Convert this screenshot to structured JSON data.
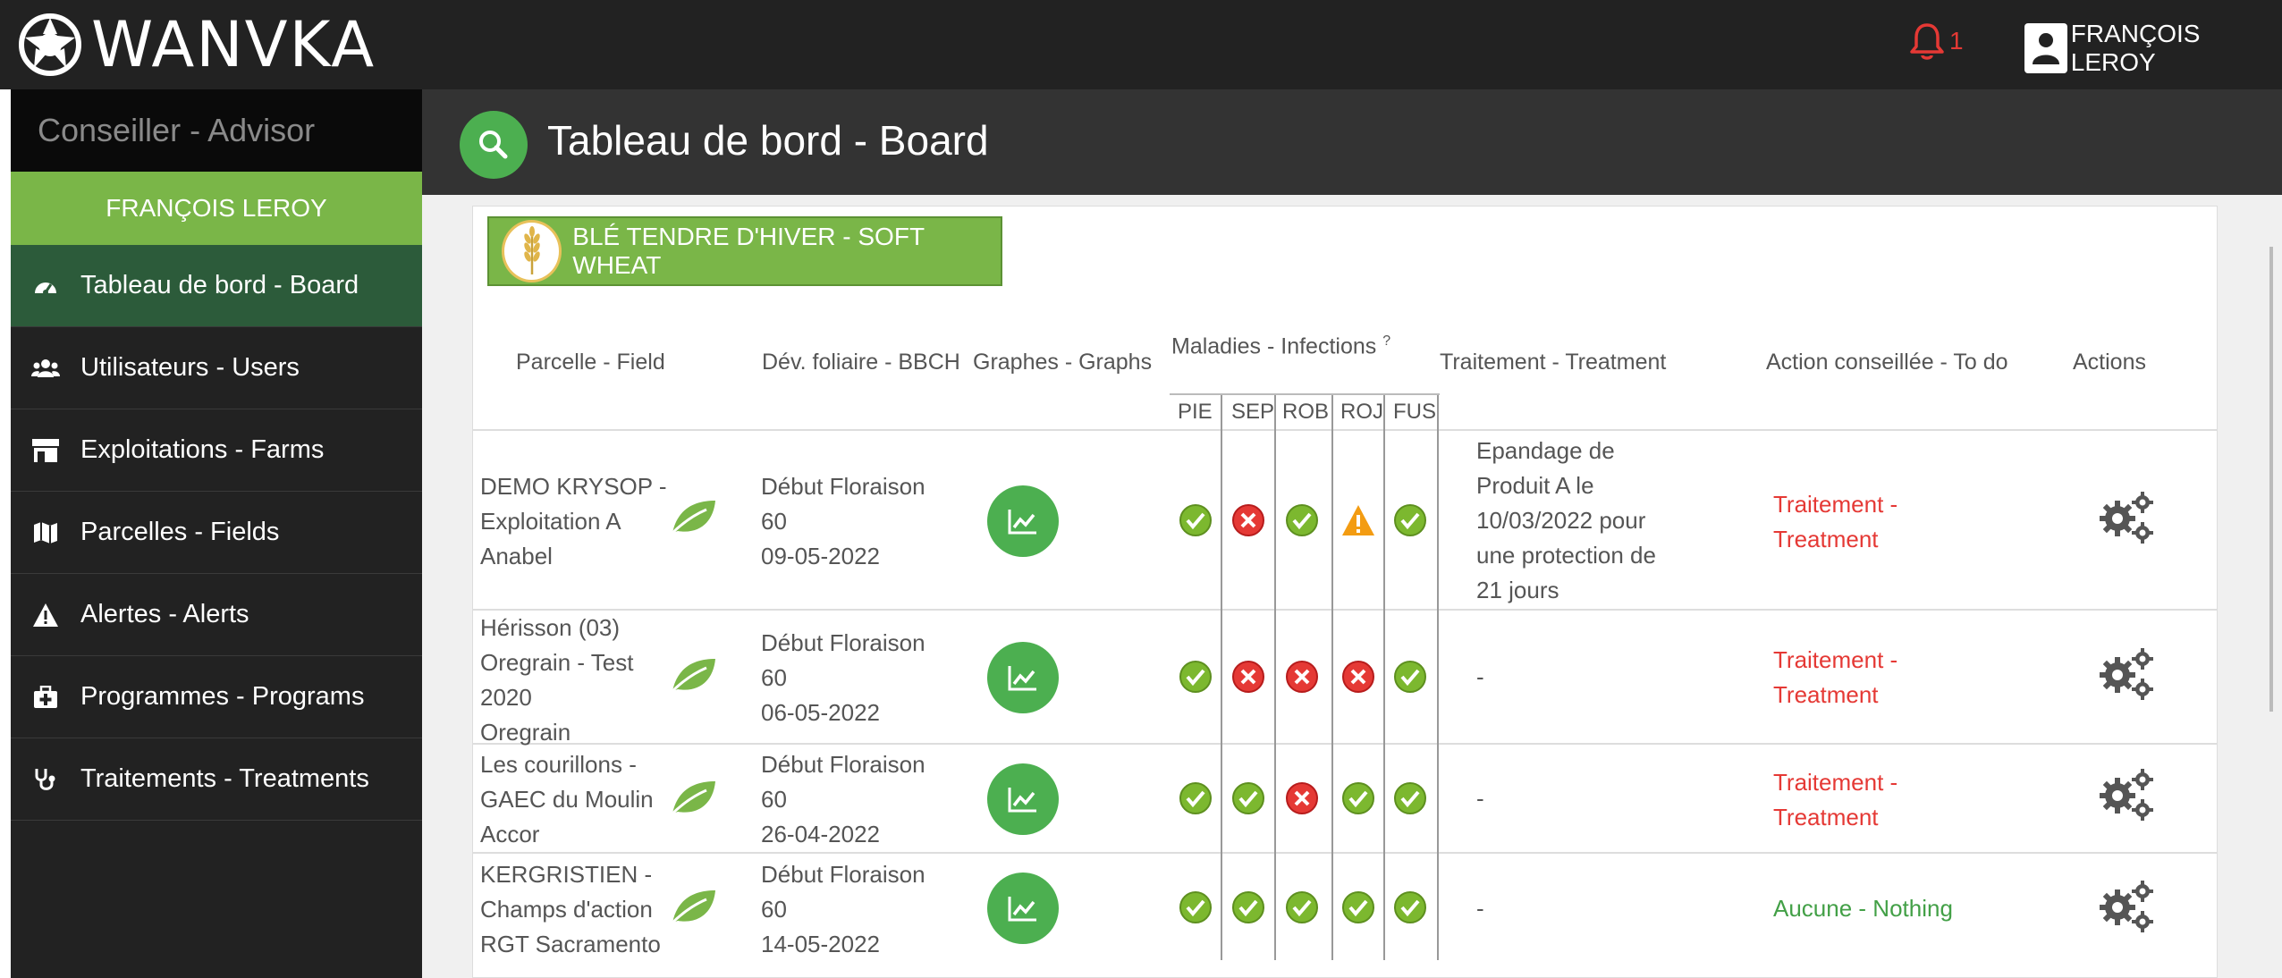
{
  "app": {
    "logo_text": "WANVKA",
    "notification_count": "1",
    "user_name": "FRANÇOIS LEROY"
  },
  "sidebar": {
    "role": "Conseiller - Advisor",
    "user_banner": "FRANÇOIS LEROY",
    "items": [
      {
        "label": "Tableau de bord - Board",
        "icon": "dashboard-icon"
      },
      {
        "label": "Utilisateurs - Users",
        "icon": "users-icon"
      },
      {
        "label": "Exploitations - Farms",
        "icon": "farm-icon"
      },
      {
        "label": "Parcelles - Fields",
        "icon": "map-icon"
      },
      {
        "label": "Alertes - Alerts",
        "icon": "alert-icon"
      },
      {
        "label": "Programmes - Programs",
        "icon": "medkit-icon"
      },
      {
        "label": "Traitements - Treatments",
        "icon": "stethoscope-icon"
      }
    ]
  },
  "header": {
    "title": "Tableau de bord - Board"
  },
  "crop_button": {
    "label": "BLÉ TENDRE D'HIVER - SOFT WHEAT"
  },
  "table": {
    "headers": {
      "field": "Parcelle - Field",
      "bbch": "Dév. foliaire - BBCH",
      "graphs": "Graphes - Graphs",
      "diseases": "Maladies - Infections",
      "diseases_sup": "?",
      "treatment": "Traitement - Treatment",
      "todo": "Action conseillée - To do",
      "actions": "Actions"
    },
    "disease_codes": [
      "PIE",
      "SEP",
      "ROB",
      "ROJ",
      "FUS"
    ],
    "rows": [
      {
        "field": [
          "DEMO KRYSOP -",
          "Exploitation A",
          "Anabel"
        ],
        "bbch": [
          "Début Floraison",
          "60",
          "09-05-2022"
        ],
        "statuses": [
          "ok",
          "bad",
          "ok",
          "warn",
          "ok"
        ],
        "treatment": [
          "Epandage de",
          "Produit A le",
          "10/03/2022 pour",
          "une protection de",
          "21 jours"
        ],
        "todo": [
          "Traitement -",
          "Treatment"
        ],
        "todo_status": "treatment"
      },
      {
        "field": [
          "Hérisson (03)",
          "Oregrain - Test",
          "2020",
          "Oregrain"
        ],
        "bbch": [
          "Début Floraison",
          "60",
          "06-05-2022"
        ],
        "statuses": [
          "ok",
          "bad",
          "bad",
          "bad",
          "ok"
        ],
        "treatment": [
          "-"
        ],
        "todo": [
          "Traitement -",
          "Treatment"
        ],
        "todo_status": "treatment"
      },
      {
        "field": [
          "Les courillons -",
          "GAEC du Moulin",
          "Accor"
        ],
        "bbch": [
          "Début Floraison",
          "60",
          "26-04-2022"
        ],
        "statuses": [
          "ok",
          "ok",
          "bad",
          "ok",
          "ok"
        ],
        "treatment": [
          "-"
        ],
        "todo": [
          "Traitement -",
          "Treatment"
        ],
        "todo_status": "treatment"
      },
      {
        "field": [
          "KERGRISTIEN -",
          "Champs d'action",
          "RGT Sacramento"
        ],
        "bbch": [
          "Début Floraison",
          "60",
          "14-05-2022"
        ],
        "statuses": [
          "ok",
          "ok",
          "ok",
          "ok",
          "ok"
        ],
        "treatment": [
          "-"
        ],
        "todo": [
          "Aucune - Nothing"
        ],
        "todo_status": "nothing"
      }
    ]
  },
  "colors": {
    "topbar": "#222222",
    "sidebar_active": "#2c5b3a",
    "accent_green": "#7ab648",
    "button_green": "#4caf50",
    "alert_red": "#e53935",
    "ok_green": "#7cb82f",
    "warn_orange": "#f39c12"
  }
}
